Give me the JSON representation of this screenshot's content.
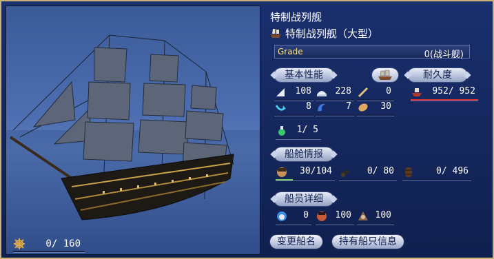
{
  "ship": {
    "title": "特制战列舰",
    "subtitle": "特制战列舰（大型）",
    "grade_label": "Grade",
    "grade_value": "0(战斗舰)",
    "capacity": "0/ 160"
  },
  "sections": {
    "basic": "基本性能",
    "durability": "耐久度",
    "cabin": "船舱情报",
    "crew": "船员详细"
  },
  "basic_stats": {
    "sail_speed": "108",
    "armor": "228",
    "cannon": "0",
    "turning": "8",
    "wave_resist": "7",
    "rowing": "30",
    "durability": "952/ 952",
    "durability_ratio": 1.0
  },
  "misc": {
    "upgrade": "1/ 5"
  },
  "cabin": {
    "sailors": "30/104",
    "sailors_ratio": 0.29,
    "cannons": "0/ 80",
    "cargo": "0/ 496"
  },
  "crew": {
    "a": "0",
    "b": "100",
    "c": "100"
  },
  "buttons": {
    "rename": "变更船名",
    "ship_info": "持有船只信息"
  },
  "colors": {
    "durability_bar": "#d9343a",
    "sailors_bar": "#7ec86a"
  }
}
